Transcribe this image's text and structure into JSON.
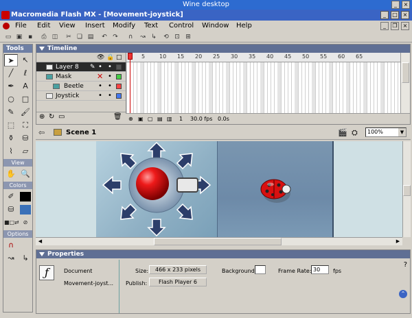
{
  "wine": {
    "title": "Wine desktop"
  },
  "app": {
    "title": "Macromedia Flash MX - [Movement-joystick]"
  },
  "menu": [
    "File",
    "Edit",
    "View",
    "Insert",
    "Modify",
    "Text",
    "Control",
    "Window",
    "Help"
  ],
  "tools": {
    "title": "Tools",
    "sections": {
      "view": "View",
      "colors": "Colors",
      "options": "Options"
    }
  },
  "timeline": {
    "title": "Timeline",
    "layers": [
      {
        "name": "Layer 8",
        "selected": true,
        "color": "#555555"
      },
      {
        "name": "Mask",
        "selected": false,
        "color": "#44cc44"
      },
      {
        "name": "Beetle",
        "selected": false,
        "color": "#ff4444"
      },
      {
        "name": "Joystick",
        "selected": false,
        "color": "#4477ee"
      }
    ],
    "ruler": [
      "1",
      "5",
      "10",
      "15",
      "20",
      "25",
      "30",
      "35",
      "40",
      "45",
      "50",
      "55",
      "60",
      "65"
    ],
    "current_frame": "1",
    "fps": "30.0 fps",
    "time": "0.0s"
  },
  "scene": {
    "label": "Scene 1",
    "zoom": "100%"
  },
  "properties": {
    "title": "Properties",
    "doc_type": "Document",
    "doc_name": "Movement-joyst...",
    "size_label": "Size:",
    "size_value": "466 x 233 pixels",
    "publish_label": "Publish:",
    "publish_value": "Flash Player 6",
    "background_label": "Background:",
    "frame_rate_label": "Frame Rate:",
    "frame_rate_value": "30",
    "fps_unit": "fps"
  },
  "colors": {
    "titlebar": "#3a64c4",
    "panel_header": "#5f6f94",
    "stage_bg": "#cfe0e4",
    "joystick_ball": "#e01010",
    "arrow": "#2c3e6a"
  }
}
